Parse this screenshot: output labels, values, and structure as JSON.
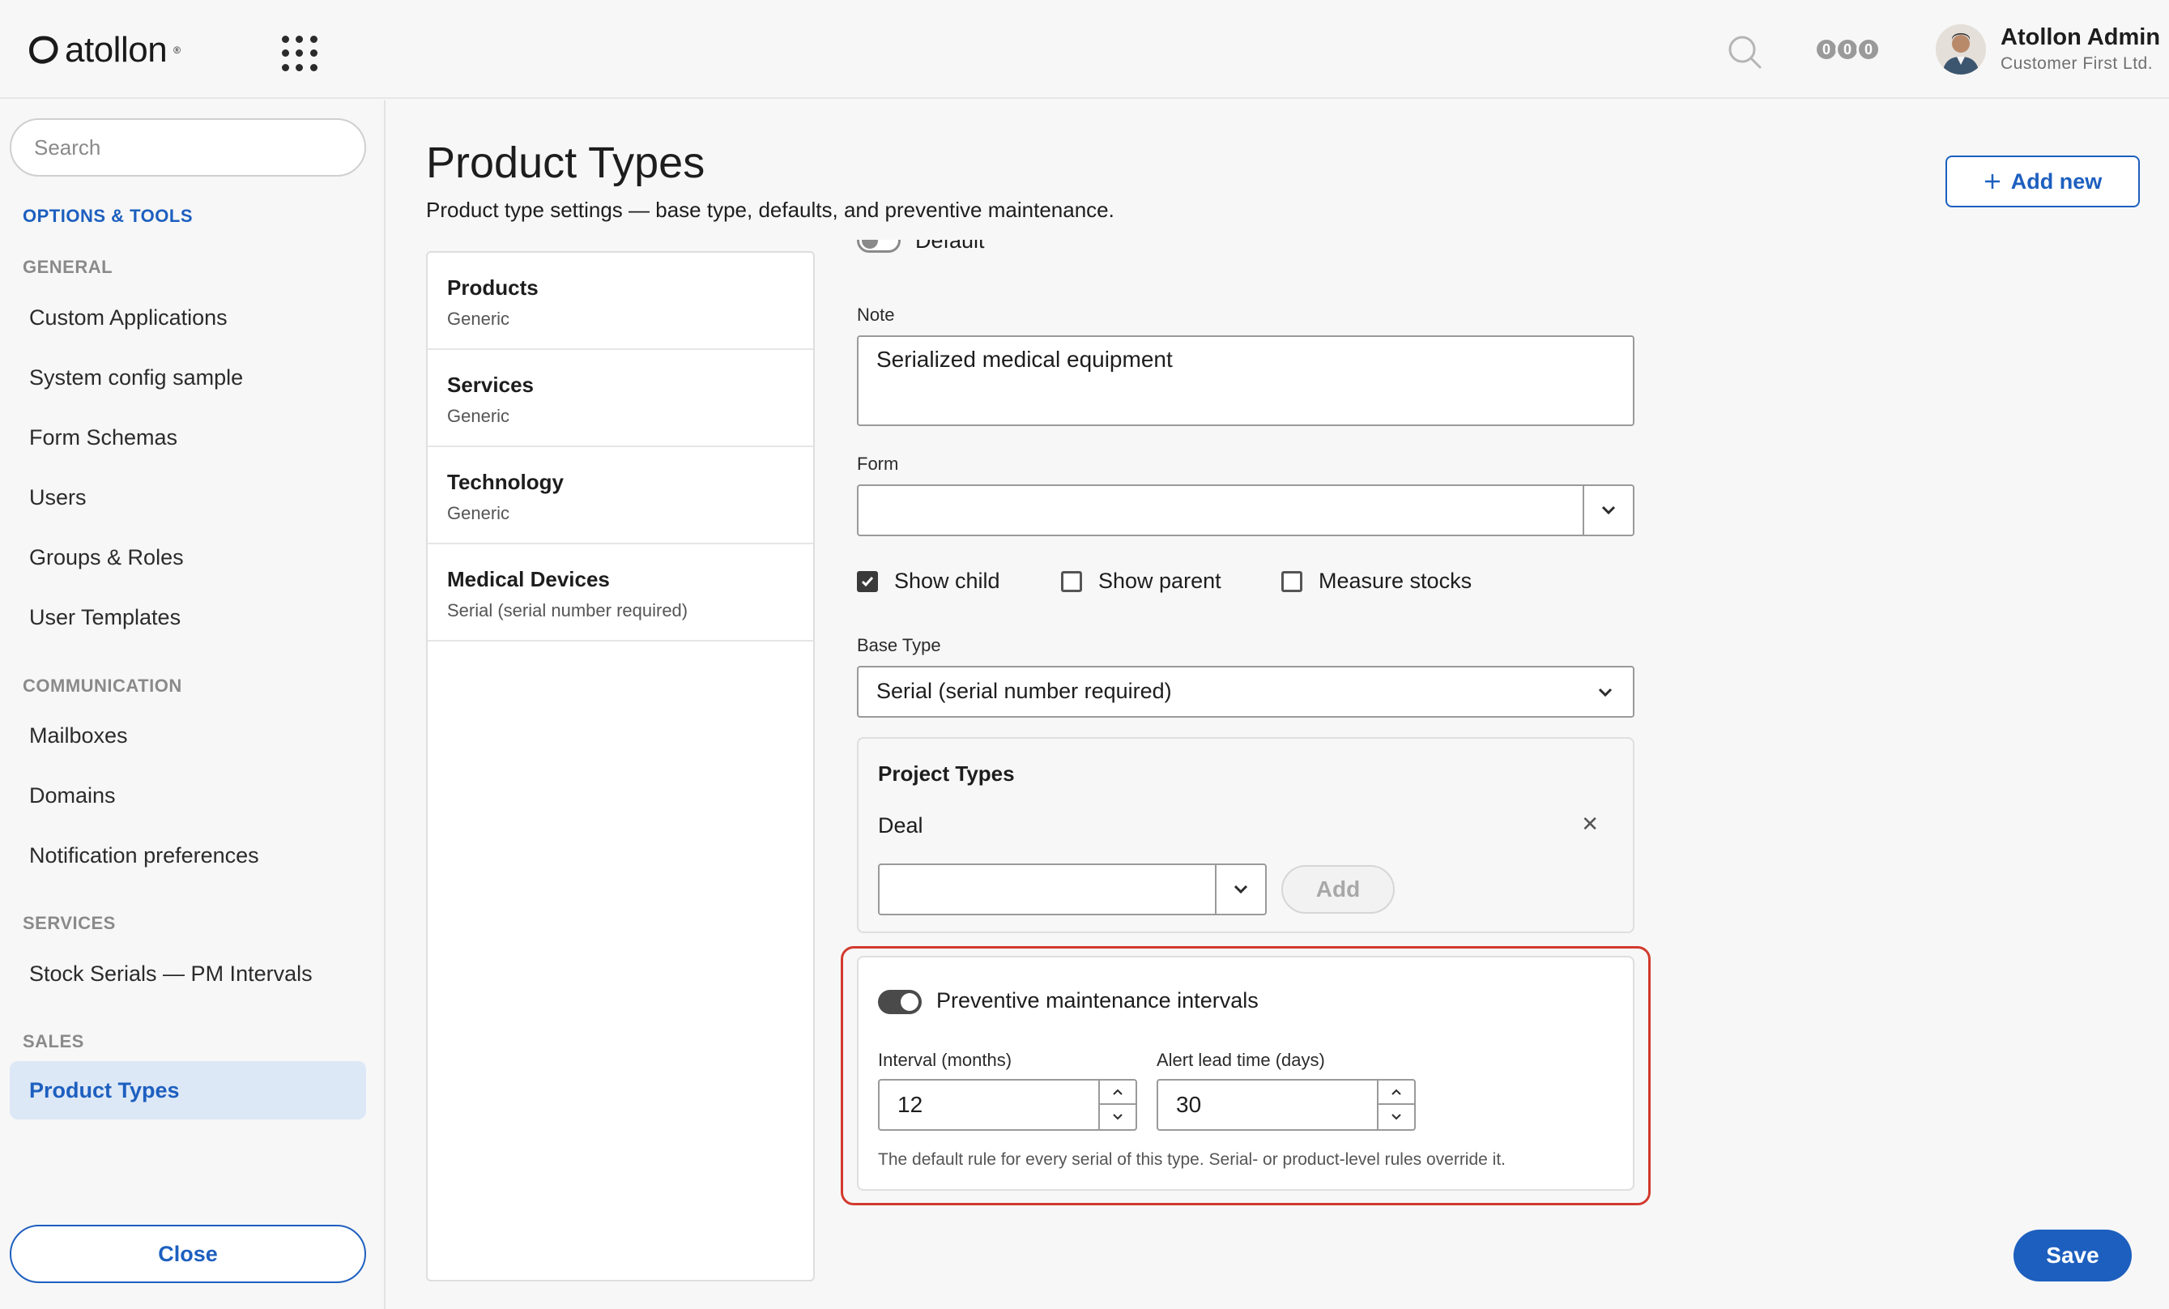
{
  "header": {
    "logo_text": "atollon",
    "logo_sup": "®",
    "counters": [
      "0",
      "0",
      "0"
    ],
    "user_name": "Atollon Admin",
    "user_org": "Customer First Ltd."
  },
  "sidebar": {
    "search_placeholder": "Search",
    "options_title": "OPTIONS & TOOLS",
    "sections": {
      "general": "GENERAL",
      "communication": "COMMUNICATION",
      "services": "SERVICES",
      "sales": "SALES"
    },
    "items": {
      "custom_applications": "Custom Applications",
      "system_config": "System config sample",
      "form_schemas": "Form Schemas",
      "users": "Users",
      "groups_roles": "Groups & Roles",
      "user_templates": "User Templates",
      "mailboxes": "Mailboxes",
      "domains": "Domains",
      "notification_preferences": "Notification preferences",
      "stock_serials": "Stock Serials — PM Intervals",
      "product_types": "Product Types"
    },
    "close_label": "Close"
  },
  "main": {
    "title": "Product Types",
    "subtitle": "Product type settings — base type, defaults, and preventive maintenance.",
    "add_new_label": "Add new",
    "types": [
      {
        "name": "Products",
        "desc": "Generic"
      },
      {
        "name": "Services",
        "desc": "Generic"
      },
      {
        "name": "Technology",
        "desc": "Generic"
      },
      {
        "name": "Medical Devices",
        "desc": "Serial (serial number required)"
      }
    ],
    "form": {
      "default_label": "Default",
      "note_label": "Note",
      "note_value": "Serialized medical equipment",
      "form_label": "Form",
      "form_value": "",
      "show_child_label": "Show child",
      "show_child": true,
      "show_parent_label": "Show parent",
      "show_parent": false,
      "measure_stocks_label": "Measure stocks",
      "measure_stocks": false,
      "base_type_label": "Base Type",
      "base_type_value": "Serial (serial number required)",
      "project_types_title": "Project Types",
      "project_types": [
        "Deal"
      ],
      "project_type_add_label": "Add",
      "pm_label": "Preventive maintenance intervals",
      "pm_enabled": true,
      "interval_label": "Interval (months)",
      "interval_value": "12",
      "alert_label": "Alert lead time (days)",
      "alert_value": "30",
      "pm_helper": "The default rule for every serial of this type. Serial- or product-level rules override it."
    },
    "save_label": "Save"
  },
  "colors": {
    "accent": "#1d5fbf",
    "highlight": "#d23a2e",
    "active_bg": "#dde8f7"
  }
}
